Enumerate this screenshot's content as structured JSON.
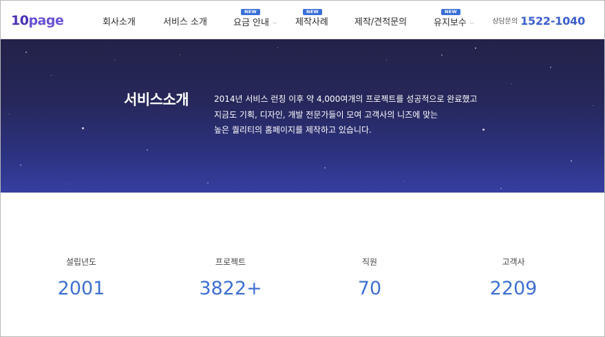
{
  "header": {
    "logo": {
      "num": "10",
      "word": "page"
    },
    "nav": [
      {
        "label": "회사소개",
        "badge": "",
        "dropdown": false
      },
      {
        "label": "서비스 소개",
        "badge": "",
        "dropdown": false
      },
      {
        "label": "요금 안내",
        "badge": "NEW",
        "dropdown": true
      },
      {
        "label": "제작사례",
        "badge": "NEW",
        "dropdown": false
      },
      {
        "label": "제작/견적문의",
        "badge": "",
        "dropdown": false
      },
      {
        "label": "유지보수",
        "badge": "NEW",
        "dropdown": true
      }
    ],
    "contact": {
      "label": "상담문의",
      "phone": "1522-1040"
    }
  },
  "hero": {
    "title": "서비스소개",
    "lines": [
      "2014년 서비스 런칭 이후 약 4,000여개의 프로젝트를 성공적으로 완료했고",
      "지금도 기획, 디자인, 개발 전문가들이 모여 고객사의 니즈에 맞는",
      "높은 퀄리티의 홈페이지를 제작하고 있습니다."
    ]
  },
  "stats": [
    {
      "label": "설립년도",
      "value": "2001"
    },
    {
      "label": "프로젝트",
      "value": "3822+"
    },
    {
      "label": "직원",
      "value": "70"
    },
    {
      "label": "고객사",
      "value": "2209"
    }
  ],
  "colors": {
    "accent": "#3e6fd2",
    "badge": "#3b6fd8",
    "hero_top": "#23224a",
    "hero_bottom": "#353fa0",
    "logo": "#4a2fb5"
  },
  "icons": {
    "dropdown": "chevron-down-icon"
  }
}
